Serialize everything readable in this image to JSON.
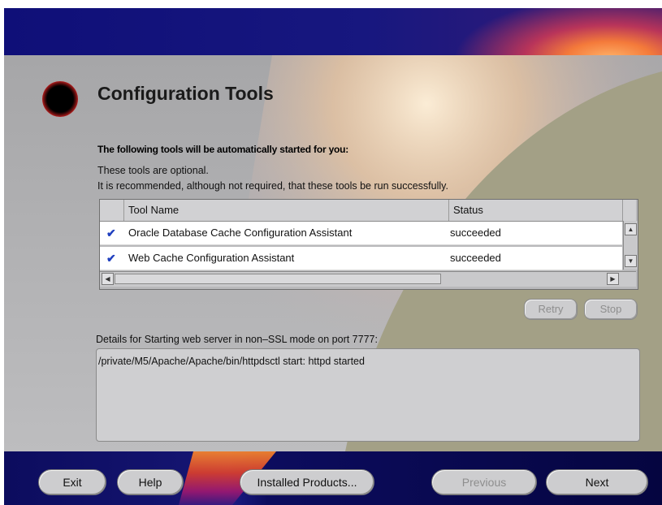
{
  "page": {
    "title": "Configuration Tools",
    "subtitle": "The following tools will be automatically started for you:",
    "optional_note": "These tools are optional.",
    "recommend_note": "It is recommended, although not required, that these tools be run successfully."
  },
  "table": {
    "headers": {
      "tool_name": "Tool Name",
      "status": "Status"
    },
    "rows": [
      {
        "checked": true,
        "name": "Oracle Database Cache Configuration Assistant",
        "status": "succeeded"
      },
      {
        "checked": true,
        "name": "Web Cache Configuration Assistant",
        "status": "succeeded"
      }
    ]
  },
  "actions": {
    "retry": "Retry",
    "stop": "Stop"
  },
  "details": {
    "label": "Details for Starting web server in non–SSL mode on port 7777:",
    "text": "/private/M5/Apache/Apache/bin/httpdsctl start: httpd started"
  },
  "nav": {
    "exit": "Exit",
    "help": "Help",
    "installed_products": "Installed Products...",
    "previous": "Previous",
    "next": "Next"
  },
  "icons": {
    "check": "✔",
    "scroll_up": "▲",
    "scroll_down": "▼",
    "scroll_left": "◀",
    "scroll_right": "▶"
  },
  "colors": {
    "banner": "#17177f",
    "accent_orange": "#f47a3a",
    "panel_gray": "#b4b4b6",
    "olive": "#a3a086",
    "check_blue": "#1f3fbf"
  }
}
